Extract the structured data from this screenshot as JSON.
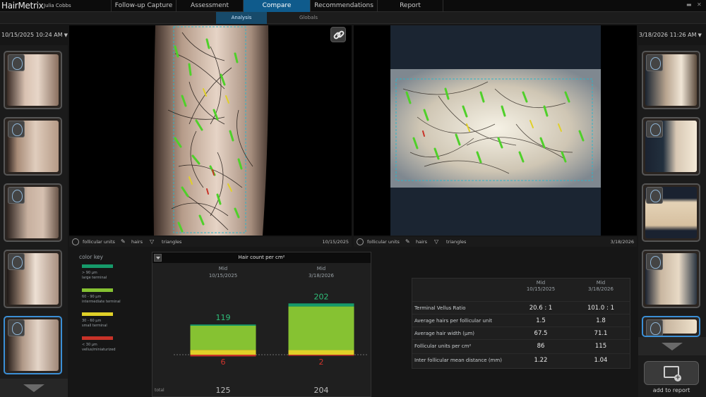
{
  "app": {
    "name": "HairMetrix",
    "patient": "Julia Cobbs"
  },
  "nav_tabs": [
    {
      "label": "Follow-up Capture",
      "active": false
    },
    {
      "label": "Assessment",
      "active": false
    },
    {
      "label": "Compare",
      "active": true
    },
    {
      "label": "Recommendations",
      "active": false
    },
    {
      "label": "Report",
      "active": false
    }
  ],
  "sub_tabs": [
    {
      "label": "Analysis",
      "active": true
    },
    {
      "label": "Globals",
      "active": false
    }
  ],
  "left": {
    "date_select": "10/15/2025 10:24 AM",
    "thumbnails": 5,
    "selected_index": 4
  },
  "right": {
    "date_select": "3/18/2026 11:26 AM",
    "thumbnails": 5,
    "selected_index": 4
  },
  "panel_left": {
    "legend": {
      "fu": "follicular units",
      "hairs": "hairs",
      "triangles": "triangles"
    },
    "date": "10/15/2025"
  },
  "panel_right": {
    "legend": {
      "fu": "follicular units",
      "hairs": "hairs",
      "triangles": "triangles"
    },
    "date": "3/18/2026"
  },
  "color_key": {
    "title": "color key",
    "items": [
      {
        "color": "#169a6a",
        "range": "> 90 µm",
        "label": "large terminal"
      },
      {
        "color": "#86c232",
        "range": "60 - 90 µm",
        "label": "intermediate terminal"
      },
      {
        "color": "#e0d028",
        "range": "30 - 60 µm",
        "label": "small terminal"
      },
      {
        "color": "#c83228",
        "range": "< 30 µm",
        "label": "vellus/miniaturized"
      }
    ]
  },
  "chart_data": {
    "type": "bar",
    "title": "Hair count per cm²",
    "categories": [
      {
        "region": "Mid",
        "date": "10/15/2025"
      },
      {
        "region": "Mid",
        "date": "3/18/2026"
      }
    ],
    "stacked_segments_order": [
      "vellus/miniaturized",
      "small terminal",
      "intermediate terminal",
      "large terminal"
    ],
    "series": [
      {
        "name": "large terminal",
        "color": "#169a6a",
        "values": [
          5,
          12
        ]
      },
      {
        "name": "intermediate terminal",
        "color": "#86c232",
        "values": [
          95,
          172
        ]
      },
      {
        "name": "small terminal",
        "color": "#e0d028",
        "values": [
          19,
          18
        ]
      },
      {
        "name": "vellus/miniaturized",
        "color": "#c83228",
        "values": [
          6,
          2
        ]
      }
    ],
    "terminal_labels": [
      "119",
      "202"
    ],
    "vellus_labels": [
      "6",
      "2"
    ],
    "total_label": "total",
    "totals": [
      "125",
      "204"
    ],
    "colors": {
      "terminal_text": "#2fbf7a",
      "vellus_text": "#d0342c"
    }
  },
  "stats": {
    "columns": [
      {
        "region": "Mid",
        "date": "10/15/2025"
      },
      {
        "region": "Mid",
        "date": "3/18/2026"
      }
    ],
    "rows": [
      {
        "label": "Terminal Vellus Ratio",
        "values": [
          "20.6 : 1",
          "101.0 : 1"
        ]
      },
      {
        "label": "Average hairs per follicular unit",
        "values": [
          "1.5",
          "1.8"
        ]
      },
      {
        "label": "Average hair width (µm)",
        "values": [
          "67.5",
          "71.1"
        ]
      },
      {
        "label": "Follicular units per cm²",
        "values": [
          "86",
          "115"
        ]
      },
      {
        "label": "Inter follicular mean distance (mm)",
        "values": [
          "1.22",
          "1.04"
        ]
      }
    ]
  },
  "actions": {
    "add_to_report": "add to report"
  }
}
